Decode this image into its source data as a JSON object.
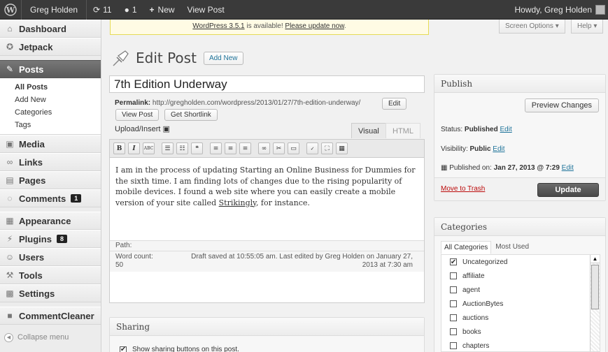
{
  "adminbar": {
    "site_name": "Greg Holden",
    "updates_count": "11",
    "comments_count": "1",
    "new_label": "New",
    "view_post_label": "View Post",
    "howdy": "Howdy, Greg Holden"
  },
  "sidebar": {
    "dashboard": "Dashboard",
    "jetpack": "Jetpack",
    "posts": "Posts",
    "posts_sub": [
      "All Posts",
      "Add New",
      "Categories",
      "Tags"
    ],
    "media": "Media",
    "links": "Links",
    "pages": "Pages",
    "comments": "Comments",
    "comments_badge": "1",
    "appearance": "Appearance",
    "plugins": "Plugins",
    "plugins_badge": "8",
    "users": "Users",
    "tools": "Tools",
    "settings": "Settings",
    "commentcleaner": "CommentCleaner",
    "collapse": "Collapse menu"
  },
  "notice": {
    "version": "WordPress 3.5.1",
    "text": " is available! ",
    "link": "Please update now",
    "end": "."
  },
  "screen_options": "Screen Options",
  "help": "Help",
  "page_title": "Edit Post",
  "add_new": "Add New",
  "post": {
    "title": "7th Edition Underway",
    "permalink_label": "Permalink:",
    "permalink_url": "http://gregholden.com/wordpress/2013/01/27/7th-edition-underway/",
    "edit": "Edit",
    "view_post": "View Post",
    "get_shortlink": "Get Shortlink",
    "upload_insert": "Upload/Insert",
    "tab_visual": "Visual",
    "tab_html": "HTML",
    "content_before_link": "I am in the process of updating Starting an Online Business for Dummies for the sixth time. I am finding lots of changes due to the rising popularity of mobile devices. I found a web site where you can easily create a mobile version of your site called ",
    "content_link": "Strikingly",
    "content_after_link": ", for instance.",
    "path_label": "Path:",
    "word_count_label": "Word count:",
    "word_count": "50",
    "draft_saved": "Draft saved at 10:55:05 am. Last edited by Greg Holden on January 27, 2013 at 7:30 am"
  },
  "publish": {
    "title": "Publish",
    "preview": "Preview Changes",
    "status_label": "Status: ",
    "status_value": "Published",
    "visibility_label": "Visibility: ",
    "visibility_value": "Public",
    "published_label": "Published on: ",
    "published_value": "Jan 27, 2013 @ 7:29",
    "edit": "Edit",
    "trash": "Move to Trash",
    "update": "Update"
  },
  "categories": {
    "title": "Categories",
    "tab_all": "All Categories",
    "tab_used": "Most Used",
    "items": [
      {
        "name": "Uncategorized",
        "checked": true
      },
      {
        "name": "affiliate",
        "checked": false
      },
      {
        "name": "agent",
        "checked": false
      },
      {
        "name": "AuctionBytes",
        "checked": false
      },
      {
        "name": "auctions",
        "checked": false
      },
      {
        "name": "books",
        "checked": false
      },
      {
        "name": "chapters",
        "checked": false
      }
    ]
  },
  "sharing": {
    "title": "Sharing",
    "show_buttons": "Show sharing buttons on this post."
  }
}
